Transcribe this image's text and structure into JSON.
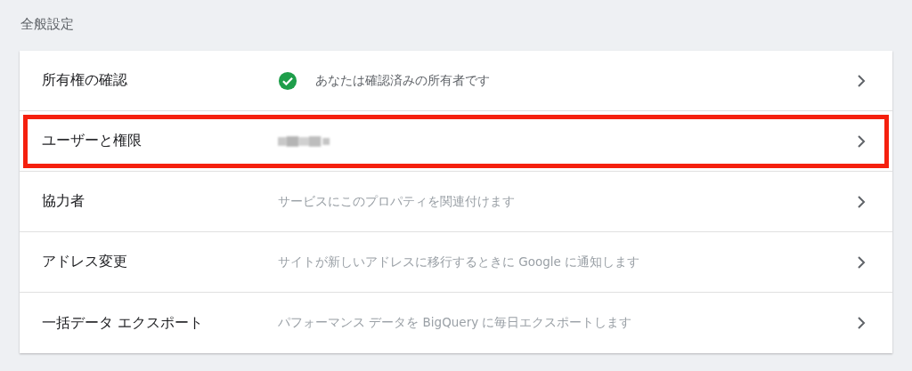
{
  "section_title": "全般設定",
  "rows": [
    {
      "label": "所有権の確認",
      "kind": "verified",
      "description": "あなたは確認済みの所有者です",
      "highlighted": false
    },
    {
      "label": "ユーザーと権限",
      "kind": "redacted",
      "highlighted": true
    },
    {
      "label": "協力者",
      "kind": "info",
      "description": "サービスにこのプロパティを関連付けます",
      "highlighted": false
    },
    {
      "label": "アドレス変更",
      "kind": "info",
      "description": "サイトが新しいアドレスに移行するときに Google に通知します",
      "highlighted": false
    },
    {
      "label": "一括データ エクスポート",
      "kind": "info",
      "description": "パフォーマンス データを BigQuery に毎日エクスポートします",
      "highlighted": false
    }
  ]
}
